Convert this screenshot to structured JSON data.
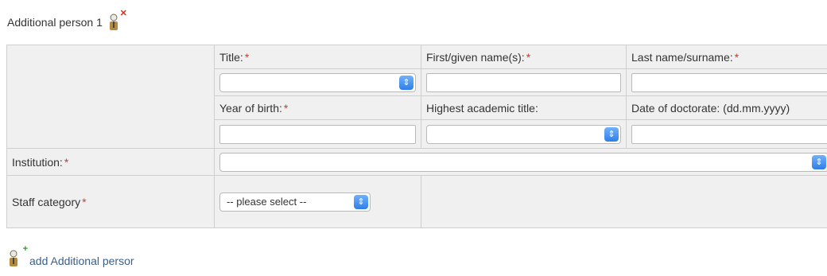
{
  "heading": {
    "title": "Additional person 1",
    "icon": "person-remove-icon"
  },
  "fields": {
    "title_label": "Title:",
    "first_name_label": "First/given name(s):",
    "last_name_label": "Last name/surname:",
    "year_of_birth_label": "Year of birth:",
    "highest_academic_title_label": "Highest academic title:",
    "date_of_doctorate_label": "Date of doctorate: (dd.mm.yyyy)",
    "institution_label": "Institution:",
    "staff_category_label": "Staff category",
    "staff_category_value": "-- please select --",
    "required_marker": "*"
  },
  "add_link": {
    "label": "add Additional persor",
    "icon": "person-add-icon"
  },
  "colors": {
    "required": "#d9342b",
    "link": "#3a5f86",
    "select_button": "#2f7ee6"
  }
}
